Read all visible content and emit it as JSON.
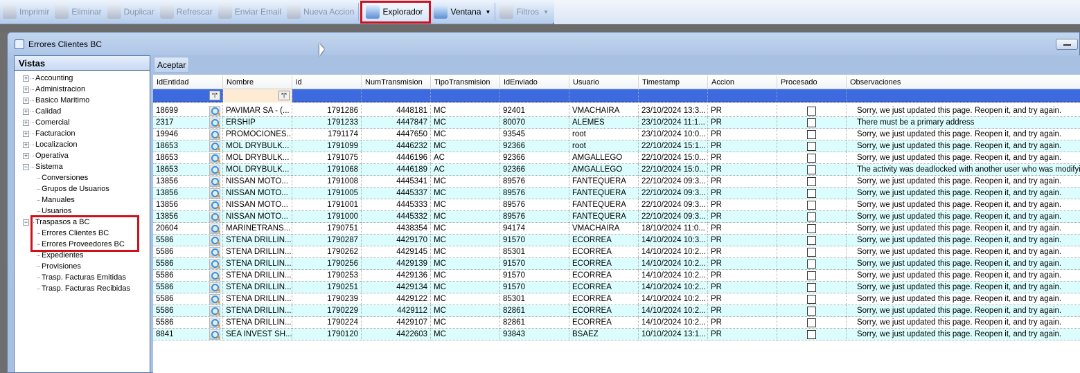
{
  "toolbar": {
    "items": [
      {
        "label": "Imprimir",
        "icon": "printer-icon",
        "enabled": false
      },
      {
        "label": "Eliminar",
        "icon": "delete-icon",
        "enabled": false
      },
      {
        "label": "Duplicar",
        "icon": "duplicate-icon",
        "enabled": false
      },
      {
        "label": "Refrescar",
        "icon": "refresh-icon",
        "enabled": false
      },
      {
        "label": "Enviar Email",
        "icon": "email-icon",
        "enabled": false
      },
      {
        "label": "Nueva Accion",
        "icon": "new-action-icon",
        "enabled": false
      }
    ],
    "explorador": "Explorador",
    "ventana": "Ventana",
    "filtros": "Filtros"
  },
  "window": {
    "title": "Errores Clientes BC"
  },
  "sidebar": {
    "title": "Vistas",
    "items": [
      {
        "label": "Accounting",
        "level": 0,
        "toggle": "+"
      },
      {
        "label": "Administracion",
        "level": 0,
        "toggle": "+"
      },
      {
        "label": "Basico Maritimo",
        "level": 0,
        "toggle": "+"
      },
      {
        "label": "Calidad",
        "level": 0,
        "toggle": "+"
      },
      {
        "label": "Comercial",
        "level": 0,
        "toggle": "+"
      },
      {
        "label": "Facturacion",
        "level": 0,
        "toggle": "+"
      },
      {
        "label": "Localizacion",
        "level": 0,
        "toggle": "+"
      },
      {
        "label": "Operativa",
        "level": 0,
        "toggle": "+"
      },
      {
        "label": "Sistema",
        "level": 0,
        "toggle": "-"
      },
      {
        "label": "Conversiones",
        "level": 1
      },
      {
        "label": "Grupos de Usuarios",
        "level": 1
      },
      {
        "label": "Manuales",
        "level": 1
      },
      {
        "label": "Usuarios",
        "level": 1
      },
      {
        "label": "Traspasos a BC",
        "level": 0,
        "toggle": "-"
      },
      {
        "label": "Errores Clientes BC",
        "level": 1
      },
      {
        "label": "Errores Proveedores BC",
        "level": 1
      },
      {
        "label": "Expedientes",
        "level": 1
      },
      {
        "label": "Provisiones",
        "level": 1
      },
      {
        "label": "Trasp. Facturas Emitidas",
        "level": 1
      },
      {
        "label": "Trasp. Facturas Recibidas",
        "level": 1
      }
    ]
  },
  "grid": {
    "accept": "Aceptar",
    "filter_button": "*|*",
    "columns": [
      "IdEntidad",
      "Nombre",
      "id",
      "NumTransmision",
      "TipoTransmision",
      "IdEnviado",
      "Usuario",
      "Timestamp",
      "Accion",
      "Procesado",
      "Observaciones"
    ],
    "rows": [
      [
        "18699",
        "PAVIMAR SA - (...",
        "1791286",
        "4448181",
        "MC",
        "92401",
        "VMACHAIRA",
        "23/10/2024  13:3...",
        "PR",
        false,
        "Sorry, we just updated this page. Reopen it, and try again."
      ],
      [
        "2317",
        "ERSHIP",
        "1791233",
        "4447847",
        "MC",
        "80070",
        "ALEMES",
        "23/10/2024  11:1...",
        "PR",
        false,
        "There must be a primary address"
      ],
      [
        "19946",
        "PROMOCIONES...",
        "1791174",
        "4447650",
        "MC",
        "93545",
        "root",
        "23/10/2024  10:0...",
        "PR",
        false,
        "Sorry, we just updated this page. Reopen it, and try again."
      ],
      [
        "18653",
        "MOL  DRYBULK...",
        "1791099",
        "4446232",
        "MC",
        "92366",
        "root",
        "22/10/2024  15:1...",
        "PR",
        false,
        "Sorry, we just updated this page. Reopen it, and try again."
      ],
      [
        "18653",
        "MOL  DRYBULK...",
        "1791075",
        "4446196",
        "AC",
        "92366",
        "AMGALLEGO",
        "22/10/2024  15:0...",
        "PR",
        false,
        "Sorry, we just updated this page. Reopen it, and try again."
      ],
      [
        "18653",
        "MOL  DRYBULK...",
        "1791068",
        "4446189",
        "AC",
        "92366",
        "AMGALLEGO",
        "22/10/2024  15:0...",
        "PR",
        false,
        "The activity was deadlocked with another user who was modifying"
      ],
      [
        "13856",
        "NISSAN  MOTO...",
        "1791008",
        "4445341",
        "MC",
        "89576",
        "FANTEQUERA",
        "22/10/2024  09:3...",
        "PR",
        false,
        "Sorry, we just updated this page. Reopen it, and try again."
      ],
      [
        "13856",
        "NISSAN  MOTO...",
        "1791005",
        "4445337",
        "MC",
        "89576",
        "FANTEQUERA",
        "22/10/2024  09:3...",
        "PR",
        false,
        "Sorry, we just updated this page. Reopen it, and try again."
      ],
      [
        "13856",
        "NISSAN  MOTO...",
        "1791001",
        "4445333",
        "MC",
        "89576",
        "FANTEQUERA",
        "22/10/2024  09:3...",
        "PR",
        false,
        "Sorry, we just updated this page. Reopen it, and try again."
      ],
      [
        "13856",
        "NISSAN  MOTO...",
        "1791000",
        "4445332",
        "MC",
        "89576",
        "FANTEQUERA",
        "22/10/2024  09:3...",
        "PR",
        false,
        "Sorry, we just updated this page. Reopen it, and try again."
      ],
      [
        "20604",
        "MARINETRANS...",
        "1790751",
        "4438354",
        "MC",
        "94174",
        "VMACHAIRA",
        "18/10/2024  11:0...",
        "PR",
        false,
        "Sorry, we just updated this page. Reopen it, and try again."
      ],
      [
        "5586",
        "STENA DRILLIN...",
        "1790287",
        "4429170",
        "MC",
        "91570",
        "ECORREA",
        "14/10/2024  10:3...",
        "PR",
        false,
        "Sorry, we just updated this page. Reopen it, and try again."
      ],
      [
        "5586",
        "STENA DRILLIN...",
        "1790262",
        "4429145",
        "MC",
        "85301",
        "ECORREA",
        "14/10/2024  10:2...",
        "PR",
        false,
        "Sorry, we just updated this page. Reopen it, and try again."
      ],
      [
        "5586",
        "STENA DRILLIN...",
        "1790256",
        "4429139",
        "MC",
        "91570",
        "ECORREA",
        "14/10/2024  10:2...",
        "PR",
        false,
        "Sorry, we just updated this page. Reopen it, and try again."
      ],
      [
        "5586",
        "STENA DRILLIN...",
        "1790253",
        "4429136",
        "MC",
        "91570",
        "ECORREA",
        "14/10/2024  10:2...",
        "PR",
        false,
        "Sorry, we just updated this page. Reopen it, and try again."
      ],
      [
        "5586",
        "STENA DRILLIN...",
        "1790251",
        "4429134",
        "MC",
        "91570",
        "ECORREA",
        "14/10/2024  10:2...",
        "PR",
        false,
        "Sorry, we just updated this page. Reopen it, and try again."
      ],
      [
        "5586",
        "STENA DRILLIN...",
        "1790239",
        "4429122",
        "MC",
        "85301",
        "ECORREA",
        "14/10/2024  10:2...",
        "PR",
        false,
        "Sorry, we just updated this page. Reopen it, and try again."
      ],
      [
        "5586",
        "STENA DRILLIN...",
        "1790229",
        "4429112",
        "MC",
        "82861",
        "ECORREA",
        "14/10/2024  10:2...",
        "PR",
        false,
        "Sorry, we just updated this page. Reopen it, and try again."
      ],
      [
        "5586",
        "STENA DRILLIN...",
        "1790224",
        "4429107",
        "MC",
        "82861",
        "ECORREA",
        "14/10/2024  10:2...",
        "PR",
        false,
        "Sorry, we just updated this page. Reopen it, and try again."
      ],
      [
        "8841",
        "SEA  INVEST SH...",
        "1790120",
        "4422603",
        "MC",
        "93843",
        "BSAEZ",
        "10/10/2024  13:1...",
        "PR",
        false,
        "Sorry, we just updated this page. Reopen it, and try again."
      ]
    ]
  }
}
